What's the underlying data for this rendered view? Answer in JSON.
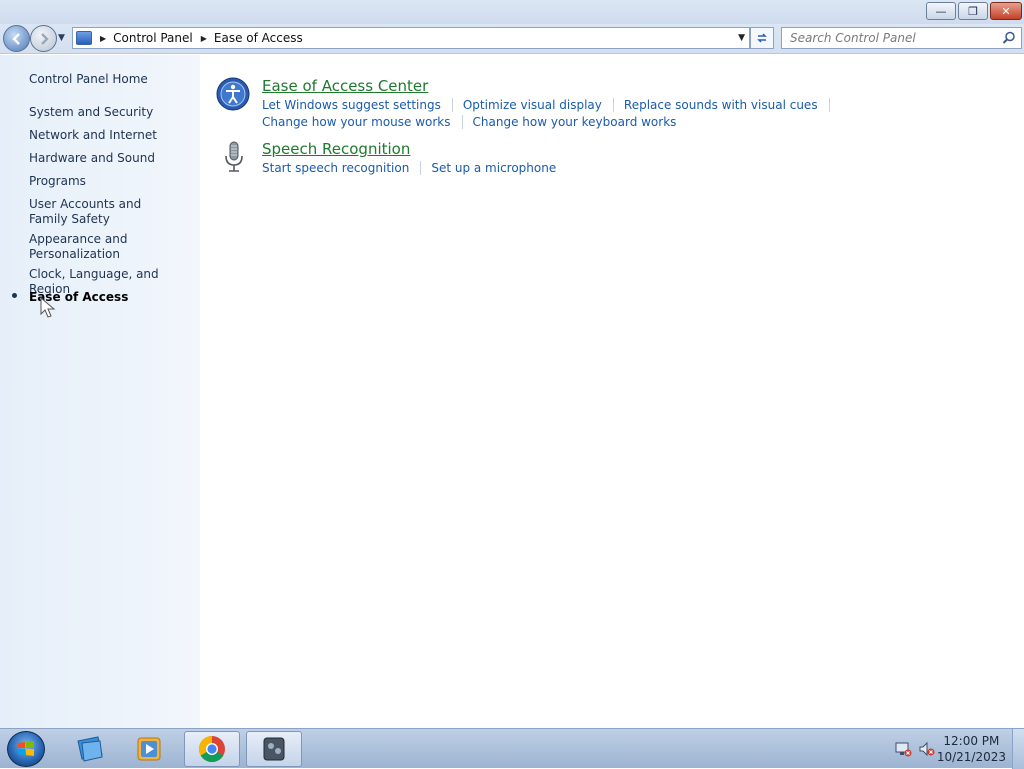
{
  "window": {
    "controls": {
      "minimize": "—",
      "maximize": "❐",
      "close": "✕"
    }
  },
  "address": {
    "breadcrumbs": [
      "Control Panel",
      "Ease of Access"
    ],
    "search_placeholder": "Search Control Panel"
  },
  "sidebar": {
    "home": "Control Panel Home",
    "items": [
      {
        "label": "System and Security"
      },
      {
        "label": "Network and Internet"
      },
      {
        "label": "Hardware and Sound"
      },
      {
        "label": "Programs"
      },
      {
        "label": "User Accounts and Family Safety"
      },
      {
        "label": "Appearance and Personalization"
      },
      {
        "label": "Clock, Language, and Region"
      },
      {
        "label": "Ease of Access",
        "current": true
      }
    ]
  },
  "main": {
    "groups": [
      {
        "title": "Ease of Access Center",
        "icon": "ease-of-access-icon",
        "links": [
          [
            "Let Windows suggest settings",
            "Optimize visual display",
            "Replace sounds with visual cues"
          ],
          [
            "Change how your mouse works",
            "Change how your keyboard works"
          ]
        ]
      },
      {
        "title": "Speech Recognition",
        "icon": "microphone-icon",
        "links": [
          [
            "Start speech recognition",
            "Set up a microphone"
          ]
        ]
      }
    ]
  },
  "taskbar": {
    "pinned": [
      "start-orb",
      "explorer-icon",
      "media-player-icon",
      "chrome-icon",
      "control-panel-icon"
    ],
    "clock_time": "12:00 PM",
    "clock_date": "10/21/2023"
  },
  "colors": {
    "link": "#1a5bae",
    "group_title": "#1e7a2d",
    "sidebar_bg": "#e6eff9"
  }
}
